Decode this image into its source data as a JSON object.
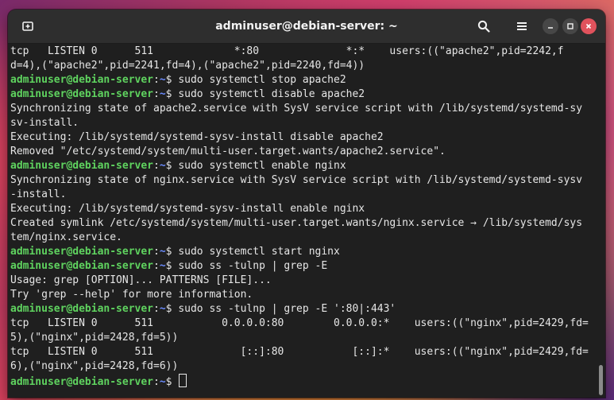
{
  "window": {
    "title": "adminuser@debian-server: ~"
  },
  "icons": {
    "new_tab": "new-tab-icon",
    "search": "search-icon",
    "menu": "hamburger-menu-icon",
    "minimize": "minimize-icon",
    "maximize": "maximize-icon",
    "close": "close-icon"
  },
  "colors": {
    "prompt_user": "#5fd35f",
    "prompt_dir": "#6b8cff",
    "terminal_bg": "#1f1f1f",
    "text": "#e6e6e6",
    "close_button": "#e0525c"
  },
  "prompt": {
    "user_host": "adminuser@debian-server",
    "separator": ":",
    "dir": "~",
    "symbol": "$ "
  },
  "terminal": {
    "lines": [
      {
        "type": "output",
        "text": "tcp   LISTEN 0      511             *:80              *:*    users:((\"apache2\",pid=2242,f"
      },
      {
        "type": "output",
        "text": "d=4),(\"apache2\",pid=2241,fd=4),(\"apache2\",pid=2240,fd=4))"
      },
      {
        "type": "command",
        "text": "sudo systemctl stop apache2"
      },
      {
        "type": "command",
        "text": "sudo systemctl disable apache2"
      },
      {
        "type": "output",
        "text": "Synchronizing state of apache2.service with SysV service script with /lib/systemd/systemd-sy"
      },
      {
        "type": "output",
        "text": "sv-install."
      },
      {
        "type": "output",
        "text": "Executing: /lib/systemd/systemd-sysv-install disable apache2"
      },
      {
        "type": "output",
        "text": "Removed \"/etc/systemd/system/multi-user.target.wants/apache2.service\"."
      },
      {
        "type": "command",
        "text": "sudo systemctl enable nginx"
      },
      {
        "type": "output",
        "text": "Synchronizing state of nginx.service with SysV service script with /lib/systemd/systemd-sysv"
      },
      {
        "type": "output",
        "text": "-install."
      },
      {
        "type": "output",
        "text": "Executing: /lib/systemd/systemd-sysv-install enable nginx"
      },
      {
        "type": "output",
        "text": "Created symlink /etc/systemd/system/multi-user.target.wants/nginx.service → /lib/systemd/sys"
      },
      {
        "type": "output",
        "text": "tem/nginx.service."
      },
      {
        "type": "command",
        "text": "sudo systemctl start nginx"
      },
      {
        "type": "command",
        "text": "sudo ss -tulnp | grep -E"
      },
      {
        "type": "output",
        "text": "Usage: grep [OPTION]... PATTERNS [FILE]..."
      },
      {
        "type": "output",
        "text": "Try 'grep --help' for more information."
      },
      {
        "type": "command",
        "text": "sudo ss -tulnp | grep -E ':80|:443'"
      },
      {
        "type": "output",
        "text": "tcp   LISTEN 0      511           0.0.0.0:80        0.0.0.0:*    users:((\"nginx\",pid=2429,fd="
      },
      {
        "type": "output",
        "text": "5),(\"nginx\",pid=2428,fd=5))"
      },
      {
        "type": "output",
        "text": "tcp   LISTEN 0      511              [::]:80           [::]:*    users:((\"nginx\",pid=2429,fd="
      },
      {
        "type": "output",
        "text": "6),(\"nginx\",pid=2428,fd=6))"
      },
      {
        "type": "command",
        "text": ""
      }
    ]
  }
}
